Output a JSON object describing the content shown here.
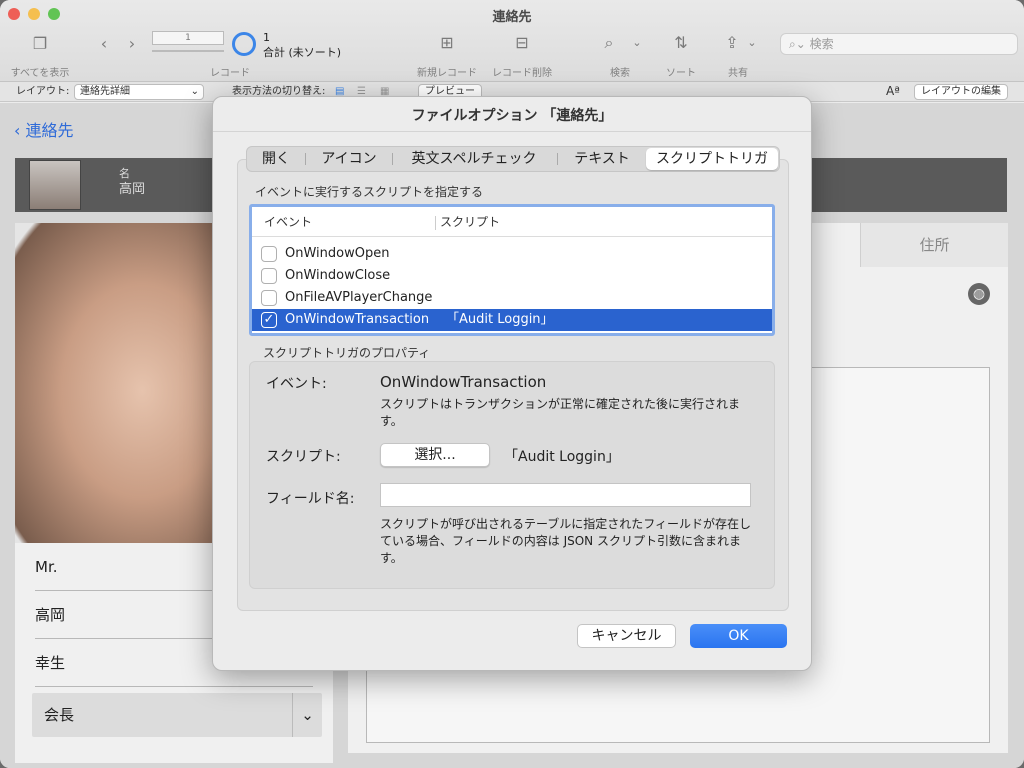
{
  "window": {
    "title": "連絡先"
  },
  "toolbar": {
    "show_all": "すべてを表示",
    "record_label": "レコード",
    "record_value": "1",
    "found_count": "1",
    "found_caption": "合計 (未ソート)",
    "new_record": "新規レコード",
    "delete_record": "レコード削除",
    "find": "検索",
    "sort": "ソート",
    "share": "共有",
    "search_placeholder": "検索"
  },
  "layout_bar": {
    "layout_label": "レイアウト:",
    "layout_value": "連絡先詳細",
    "view_as_label": "表示方法の切り替え:",
    "preview_button": "プレビュー",
    "edit_layout_button": "レイアウトの編集"
  },
  "content": {
    "back_link": "連絡先",
    "name_caption": "名",
    "name_value": "高岡",
    "fields": [
      "Mr.",
      "高岡",
      "幸生"
    ],
    "title_select": "会長",
    "address_tab": "住所"
  },
  "dialog": {
    "title": "ファイルオプション 「連絡先」",
    "tabs": [
      {
        "label": "開く"
      },
      {
        "label": "アイコン"
      },
      {
        "label": "英文スペルチェック"
      },
      {
        "label": "テキスト"
      },
      {
        "label": "スクリプトトリガ",
        "selected": true
      }
    ],
    "section_label": "イベントに実行するスクリプトを指定する",
    "table": {
      "col_event": "イベント",
      "col_script": "スクリプト",
      "rows": [
        {
          "event": "OnWindowOpen",
          "script": "",
          "checked": false
        },
        {
          "event": "OnWindowClose",
          "script": "",
          "checked": false
        },
        {
          "event": "OnFileAVPlayerChange",
          "script": "",
          "checked": false
        },
        {
          "event": "OnWindowTransaction",
          "script": "「Audit Loggin」",
          "checked": true
        }
      ]
    },
    "properties": {
      "section_label": "スクリプトトリガのプロパティ",
      "event_label": "イベント:",
      "event_value": "OnWindowTransaction",
      "event_desc": "スクリプトはトランザクションが正常に確定された後に実行されます。",
      "script_label": "スクリプト:",
      "select_button": "選択...",
      "script_value": "「Audit Loggin」",
      "field_label": "フィールド名:",
      "field_value": "",
      "field_desc": "スクリプトが呼び出されるテーブルに指定されたフィールドが存在している場合、フィールドの内容は JSON スクリプト引数に含まれます。"
    },
    "cancel_button": "キャンセル",
    "ok_button": "OK"
  }
}
